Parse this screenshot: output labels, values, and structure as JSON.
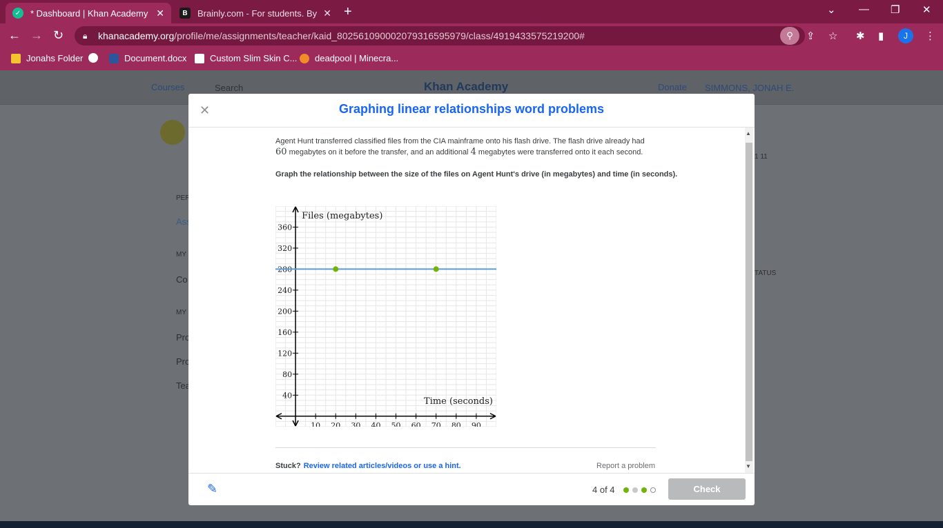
{
  "browser": {
    "tabs": [
      {
        "title": "* Dashboard | Khan Academy",
        "active": true
      },
      {
        "title": "Brainly.com - For students. By stu",
        "active": false
      }
    ],
    "new_tab": "+",
    "url_host": "khanacademy.org",
    "url_path": "/profile/me/assignments/teacher/kaid_802561090002079316595979/class/4919433575219200#",
    "profile_initial": "J",
    "bookmarks": [
      "Jonahs Folder",
      "Document.docx",
      "Custom Slim Skin C...",
      "deadpool | Minecra..."
    ]
  },
  "background_page": {
    "nav": {
      "courses": "Courses",
      "search": "Search",
      "logo": "Khan Academy",
      "donate": "Donate",
      "user": "SIMMONS, JONAH E."
    },
    "side_items": [
      "PER",
      "Ass",
      "MY",
      "Co",
      "MY",
      "Pro",
      "Pro",
      "Tea"
    ],
    "right_fragments": {
      "count": "1  11",
      "status": "TATUS"
    }
  },
  "modal": {
    "title": "Graphing linear relationships word problems",
    "problem_text_1": "Agent Hunt transferred classified files from the CIA mainframe onto his flash drive. The flash drive already had",
    "problem_num_1": "60",
    "problem_text_2": " megabytes on it before the transfer, and an additional ",
    "problem_num_2": "4",
    "problem_text_3": " megabytes were transferred onto it each second.",
    "instruction": "Graph the relationship between the size of the files on Agent Hunt's drive (in megabytes) and time (in seconds).",
    "stuck": "Stuck?",
    "hint_link": "Review related articles/videos or use a hint.",
    "report": "Report a problem",
    "progress": "4 of 4",
    "progress_dots": [
      "correct",
      "incomplete",
      "correct",
      "current"
    ],
    "check": "Check"
  },
  "chart_data": {
    "type": "line",
    "xlabel": "Time (seconds)",
    "ylabel": "Files (megabytes)",
    "xlim": [
      -10,
      100
    ],
    "ylim": [
      -20,
      400
    ],
    "x_ticks": [
      10,
      20,
      30,
      40,
      50,
      60,
      70,
      80,
      90
    ],
    "y_ticks": [
      40,
      80,
      120,
      160,
      200,
      240,
      280,
      320,
      360
    ],
    "series": [
      {
        "points": [
          {
            "x": 20,
            "y": 280
          },
          {
            "x": 70,
            "y": 280
          }
        ],
        "line_color": "#5a9bd5",
        "point_color": "#71b307"
      }
    ],
    "grid": true
  }
}
